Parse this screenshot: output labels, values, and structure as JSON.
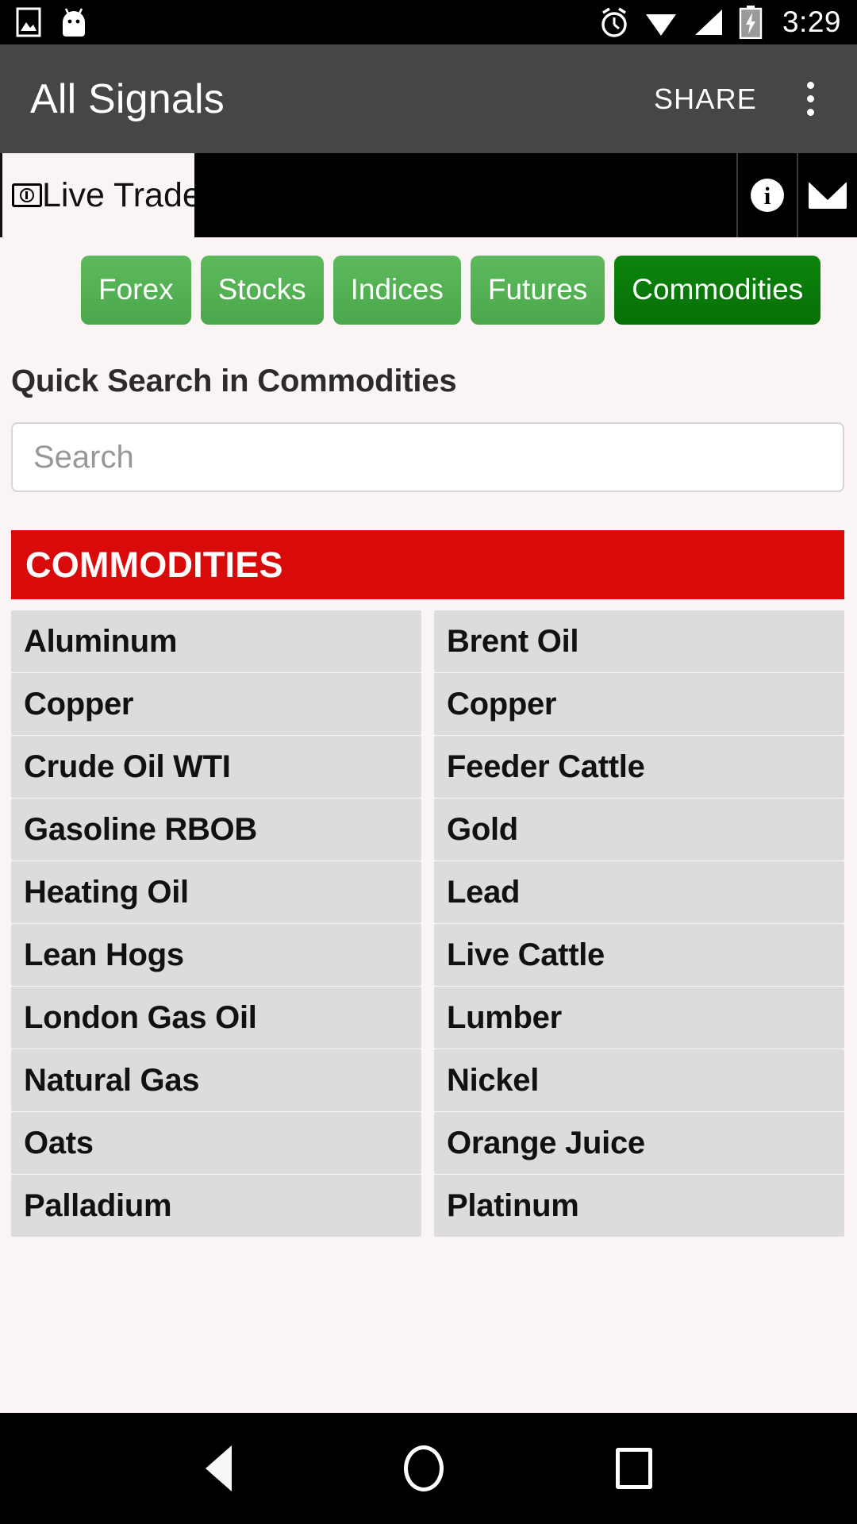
{
  "statusbar": {
    "time": "3:29",
    "icons": [
      "image-icon",
      "android-robot-icon",
      "alarm-icon",
      "wifi-icon",
      "signal-icon",
      "battery-charging-icon"
    ]
  },
  "appbar": {
    "title": "All Signals",
    "share_label": "SHARE",
    "overflow_name": "more-options-icon"
  },
  "tabstrip": {
    "active_tab_label": "Live Trades",
    "active_tab_icon": "money-note-icon",
    "info_icon": "info-icon",
    "mail_icon": "mail-icon"
  },
  "categories": [
    {
      "label": "Forex",
      "active": false
    },
    {
      "label": "Stocks",
      "active": false
    },
    {
      "label": "Indices",
      "active": false
    },
    {
      "label": "Futures",
      "active": false
    },
    {
      "label": "Commodities",
      "active": true
    }
  ],
  "search": {
    "heading": "Quick Search in Commodities",
    "placeholder": "Search",
    "value": ""
  },
  "section": {
    "title": "COMMODITIES",
    "accent_color": "#d90a0a"
  },
  "commodities": [
    "Aluminum",
    "Brent Oil",
    "Copper",
    "Copper",
    "Crude Oil WTI",
    "Feeder Cattle",
    "Gasoline RBOB",
    "Gold",
    "Heating Oil",
    "Lead",
    "Lean Hogs",
    "Live Cattle",
    "London Gas Oil",
    "Lumber",
    "Natural Gas",
    "Nickel",
    "Oats",
    "Orange Juice",
    "Palladium",
    "Platinum"
  ],
  "navbar": {
    "back": "back-nav-icon",
    "home": "home-nav-icon",
    "recents": "recents-nav-icon"
  },
  "colors": {
    "chip": "#54b054",
    "chip_active": "#0a7a0a",
    "appbar": "#464646",
    "page_bg": "#faf5f4",
    "item_bg": "#dcdcdc"
  }
}
